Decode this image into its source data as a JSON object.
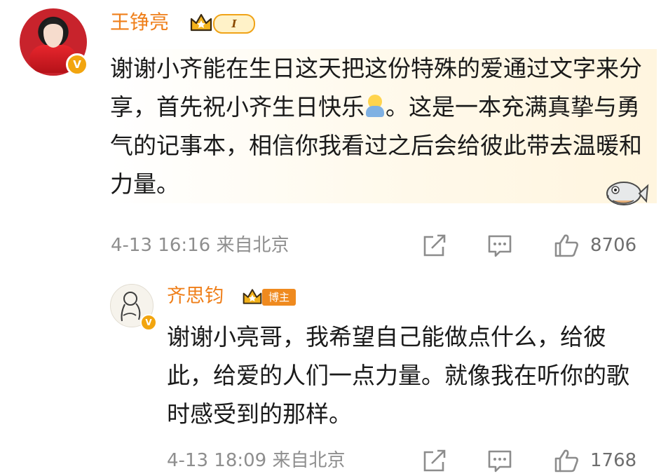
{
  "main_comment": {
    "username": "王铮亮",
    "level": "I",
    "text_before_emoji": "谢谢小齐能在生日这天把这份特殊的爱通过文字来分享，首先祝小齐生日快乐",
    "text_after_emoji": "。这是一本充满真挚与勇气的记事本，相信你我看过之后会给彼此带去温暖和力量。",
    "time_location": "4-13 16:16 来自北京",
    "like_count": "8706"
  },
  "reply": {
    "username": "齐思钧",
    "badge": "博主",
    "text": "谢谢小亮哥，我希望自己能做点什么，给彼此，给爱的人们一点力量。就像我在听你的歌时感受到的那样。",
    "time_location": "4-13 18:09 来自北京",
    "like_count": "1768"
  },
  "icons": {
    "verified": "V",
    "crown": "crown-icon",
    "share": "share-icon",
    "comment": "comment-icon",
    "like": "thumbs-up-icon",
    "fish": "fish-sticker-icon"
  },
  "colors": {
    "username": "#ef7f1a",
    "text": "#1a1a1a",
    "meta": "#8e8e8e",
    "badge": "#f2a50f",
    "host_badge": "#ef8a1f"
  }
}
